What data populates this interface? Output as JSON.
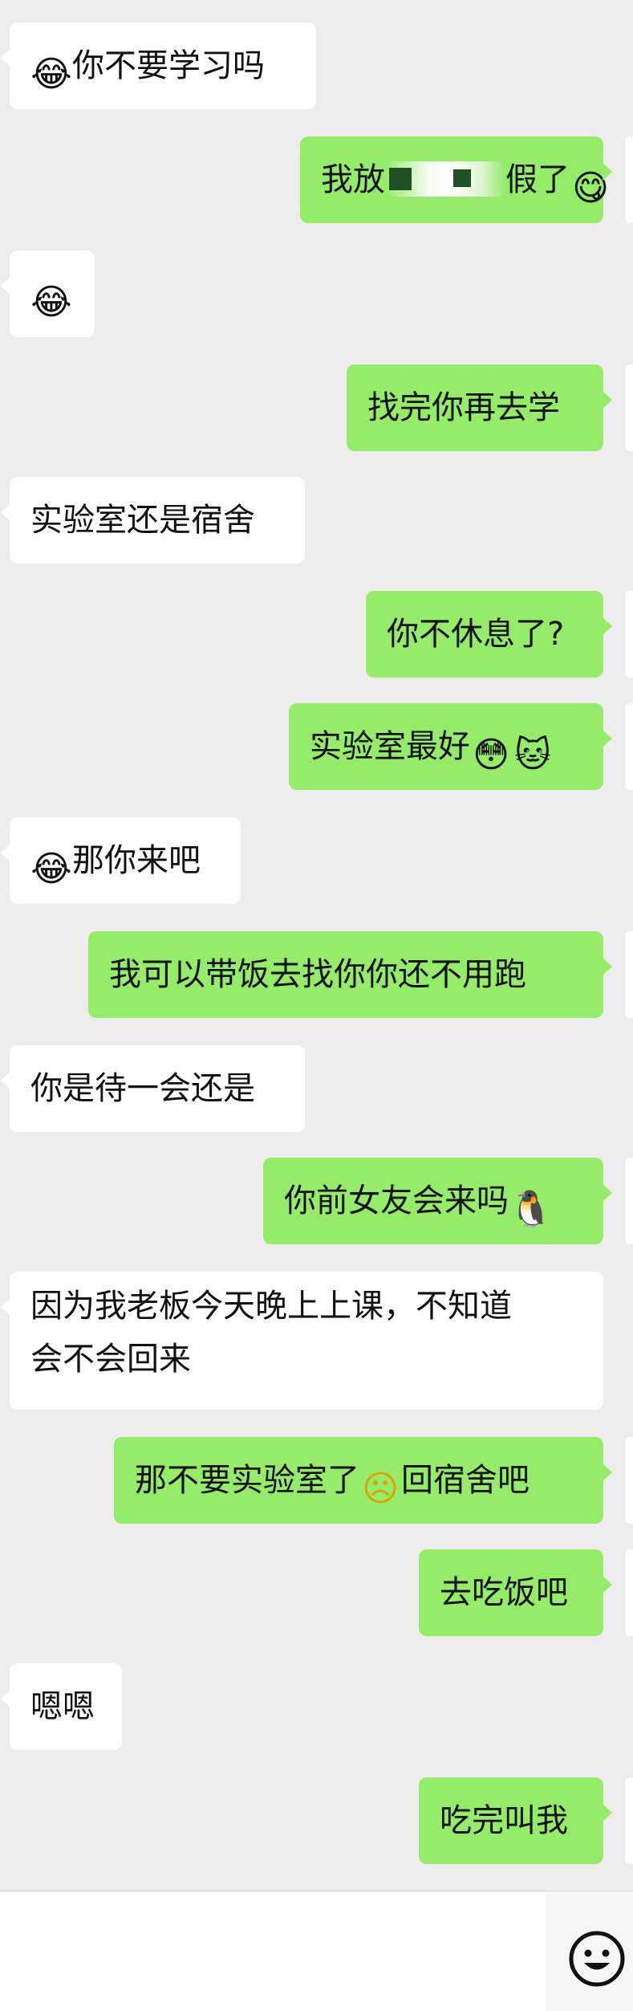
{
  "messages": [
    {
      "side": "in",
      "emoji": "😂",
      "text": "你不要学习吗"
    },
    {
      "side": "out",
      "text_before": "我放",
      "text_after": "假了",
      "emoji": "😋"
    },
    {
      "side": "in",
      "emoji": "😂",
      "text": ""
    },
    {
      "side": "out",
      "text": "找完你再去学"
    },
    {
      "side": "in",
      "text": "实验室还是宿舍"
    },
    {
      "side": "out",
      "text": "你不休息了?"
    },
    {
      "side": "out",
      "text": "实验室最好",
      "emoji1": "😳",
      "emoji2": "🐱"
    },
    {
      "side": "in",
      "emoji": "😂",
      "text": "那你来吧"
    },
    {
      "side": "out",
      "text": "我可以带饭去找你你还不用跑"
    },
    {
      "side": "in",
      "text": "你是待一会还是"
    },
    {
      "side": "out",
      "text": "你前女友会来吗",
      "emoji": "🐧"
    },
    {
      "side": "in",
      "line1": "因为我老板今天晚上上课，不知道",
      "line2": "会不会回来"
    },
    {
      "side": "out",
      "text_before": "那不要实验室了",
      "emoji": "☹",
      "text_after": "回宿舍吧"
    },
    {
      "side": "out",
      "text": "去吃饭吧"
    },
    {
      "side": "in",
      "text": "嗯嗯"
    },
    {
      "side": "out",
      "text": "吃完叫我"
    }
  ],
  "input_bar": {
    "emoji_button_icon": "smile-face-icon"
  }
}
